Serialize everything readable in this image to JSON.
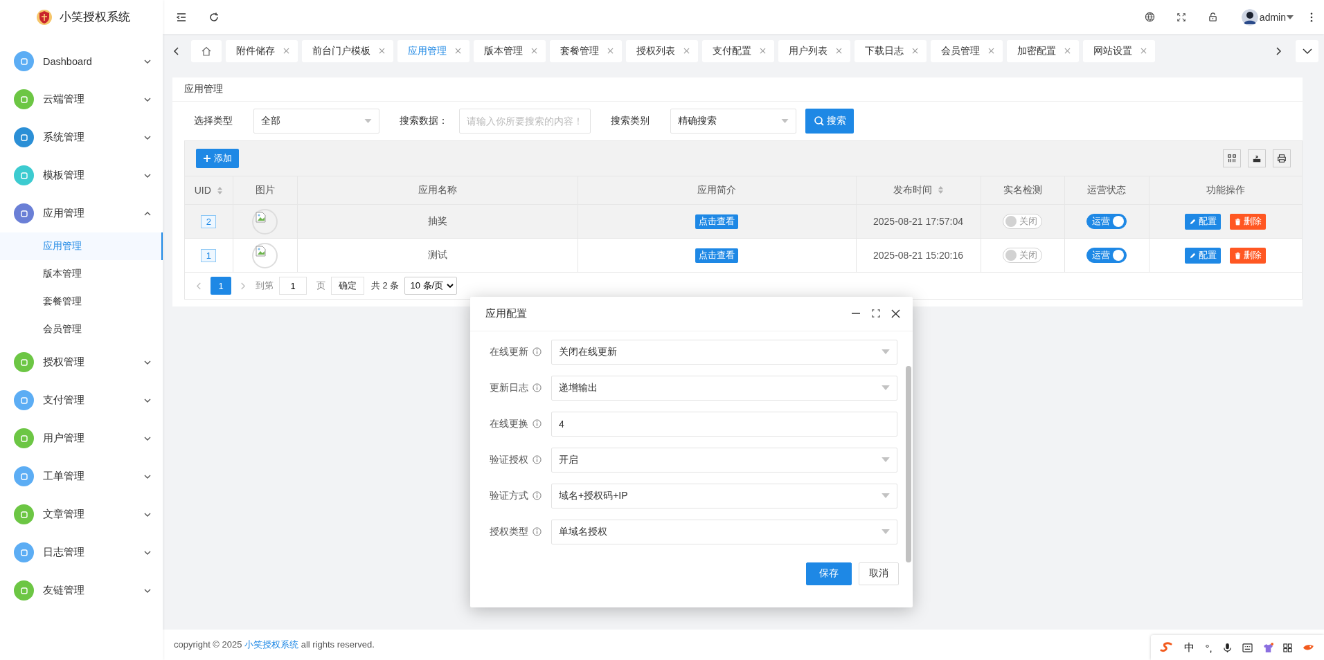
{
  "brand": {
    "title": "小笑授权系统"
  },
  "sidebar": {
    "items": [
      {
        "label": "Dashboard",
        "color": "#5cadf4",
        "expanded": false
      },
      {
        "label": "云端管理",
        "color": "#6cc644",
        "expanded": false
      },
      {
        "label": "系统管理",
        "color": "#2b8fd6",
        "expanded": false
      },
      {
        "label": "模板管理",
        "color": "#3ccbd0",
        "expanded": false
      },
      {
        "label": "应用管理",
        "color": "#6a7fd6",
        "expanded": true,
        "children": [
          {
            "label": "应用管理",
            "selected": true
          },
          {
            "label": "版本管理",
            "selected": false
          },
          {
            "label": "套餐管理",
            "selected": false
          },
          {
            "label": "会员管理",
            "selected": false
          }
        ]
      },
      {
        "label": "授权管理",
        "color": "#6cc644",
        "expanded": false
      },
      {
        "label": "支付管理",
        "color": "#5cadf4",
        "expanded": false
      },
      {
        "label": "用户管理",
        "color": "#6cc644",
        "expanded": false
      },
      {
        "label": "工单管理",
        "color": "#5cadf4",
        "expanded": false
      },
      {
        "label": "文章管理",
        "color": "#6cc644",
        "expanded": false
      },
      {
        "label": "日志管理",
        "color": "#5cadf4",
        "expanded": false
      },
      {
        "label": "友链管理",
        "color": "#6cc644",
        "expanded": false
      }
    ]
  },
  "header": {
    "user": "admin"
  },
  "tabs": [
    {
      "kind": "home",
      "selected": false
    },
    {
      "kind": "page",
      "label": "附件储存",
      "selected": false
    },
    {
      "kind": "page",
      "label": "前台门户模板",
      "selected": false
    },
    {
      "kind": "page",
      "label": "应用管理",
      "selected": true
    },
    {
      "kind": "page",
      "label": "版本管理",
      "selected": false
    },
    {
      "kind": "page",
      "label": "套餐管理",
      "selected": false
    },
    {
      "kind": "page",
      "label": "授权列表",
      "selected": false
    },
    {
      "kind": "page",
      "label": "支付配置",
      "selected": false
    },
    {
      "kind": "page",
      "label": "用户列表",
      "selected": false
    },
    {
      "kind": "page",
      "label": "下载日志",
      "selected": false
    },
    {
      "kind": "page",
      "label": "会员管理",
      "selected": false
    },
    {
      "kind": "page",
      "label": "加密配置",
      "selected": false
    },
    {
      "kind": "page",
      "label": "网站设置",
      "selected": false
    }
  ],
  "page": {
    "title": "应用管理"
  },
  "filters": [
    {
      "label": "选择类型",
      "kind": "select",
      "value": "全部"
    },
    {
      "label": "搜索数据：",
      "kind": "input",
      "placeholder": "请输入你所要搜索的内容！"
    },
    {
      "label": "搜索类别",
      "kind": "select",
      "value": "精确搜索"
    }
  ],
  "search_button": "搜索",
  "add_button": "添加",
  "table": {
    "columns": [
      {
        "label": "UID",
        "sortable": true
      },
      {
        "label": "图片",
        "sortable": false
      },
      {
        "label": "应用名称",
        "sortable": false
      },
      {
        "label": "应用简介",
        "sortable": false
      },
      {
        "label": "发布时间",
        "sortable": true
      },
      {
        "label": "实名检测",
        "sortable": false
      },
      {
        "label": "运营状态",
        "sortable": false
      },
      {
        "label": "功能操作",
        "sortable": false
      }
    ],
    "rows": [
      {
        "uid": "2",
        "highlighted": true,
        "name": "抽奖",
        "intro": "点击查看",
        "time": "2025-08-21 17:57:04",
        "realname": {
          "on": false,
          "label": "关闭"
        },
        "status": {
          "on": true,
          "label": "运营"
        },
        "actions": [
          "配置",
          "删除"
        ]
      },
      {
        "uid": "1",
        "highlighted": false,
        "name": "测试",
        "intro": "点击查看",
        "time": "2025-08-21 15:20:16",
        "realname": {
          "on": false,
          "label": "关闭"
        },
        "status": {
          "on": true,
          "label": "运营"
        },
        "actions": [
          "配置",
          "删除"
        ]
      }
    ]
  },
  "pagination": {
    "pages": [
      {
        "label": "1",
        "selected": true
      }
    ],
    "goto_label": "到第",
    "goto_value": "1",
    "page_unit": "页",
    "confirm": "确定",
    "total": "共 2 条",
    "page_size": "10 条/页"
  },
  "dialog": {
    "title": "应用配置",
    "fields": [
      {
        "label": "在线更新",
        "kind": "select",
        "value": "关闭在线更新"
      },
      {
        "label": "更新日志",
        "kind": "select",
        "value": "递增输出"
      },
      {
        "label": "在线更换",
        "kind": "input",
        "value": "4"
      },
      {
        "label": "验证授权",
        "kind": "select",
        "value": "开启"
      },
      {
        "label": "验证方式",
        "kind": "select",
        "value": "域名+授权码+IP"
      },
      {
        "label": "授权类型",
        "kind": "select",
        "value": "单域名授权"
      }
    ],
    "buttons": [
      {
        "label": "保存",
        "kind": "primary"
      },
      {
        "label": "取消",
        "kind": "default"
      }
    ]
  },
  "footer": {
    "prefix": "copyright © 2025 ",
    "link": "小笑授权系统",
    "suffix": " all rights reserved."
  },
  "ime_bar": {
    "mode": "中",
    "punct": "°,"
  }
}
